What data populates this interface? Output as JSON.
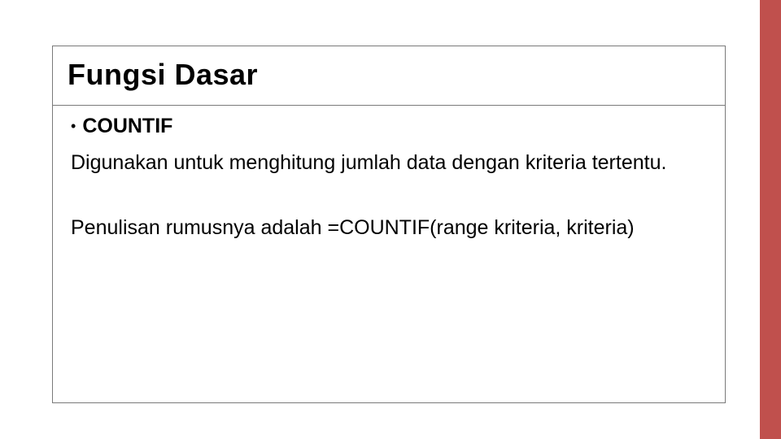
{
  "slide": {
    "title": "Fungsi Dasar",
    "bullet_dot": "•",
    "function_name": "COUNTIF",
    "paragraph1": "Digunakan untuk menghitung jumlah data dengan kriteria tertentu.",
    "paragraph2": "Penulisan rumusnya adalah =COUNTIF(range kriteria, kriteria)"
  },
  "accent_color": "#c0504d"
}
